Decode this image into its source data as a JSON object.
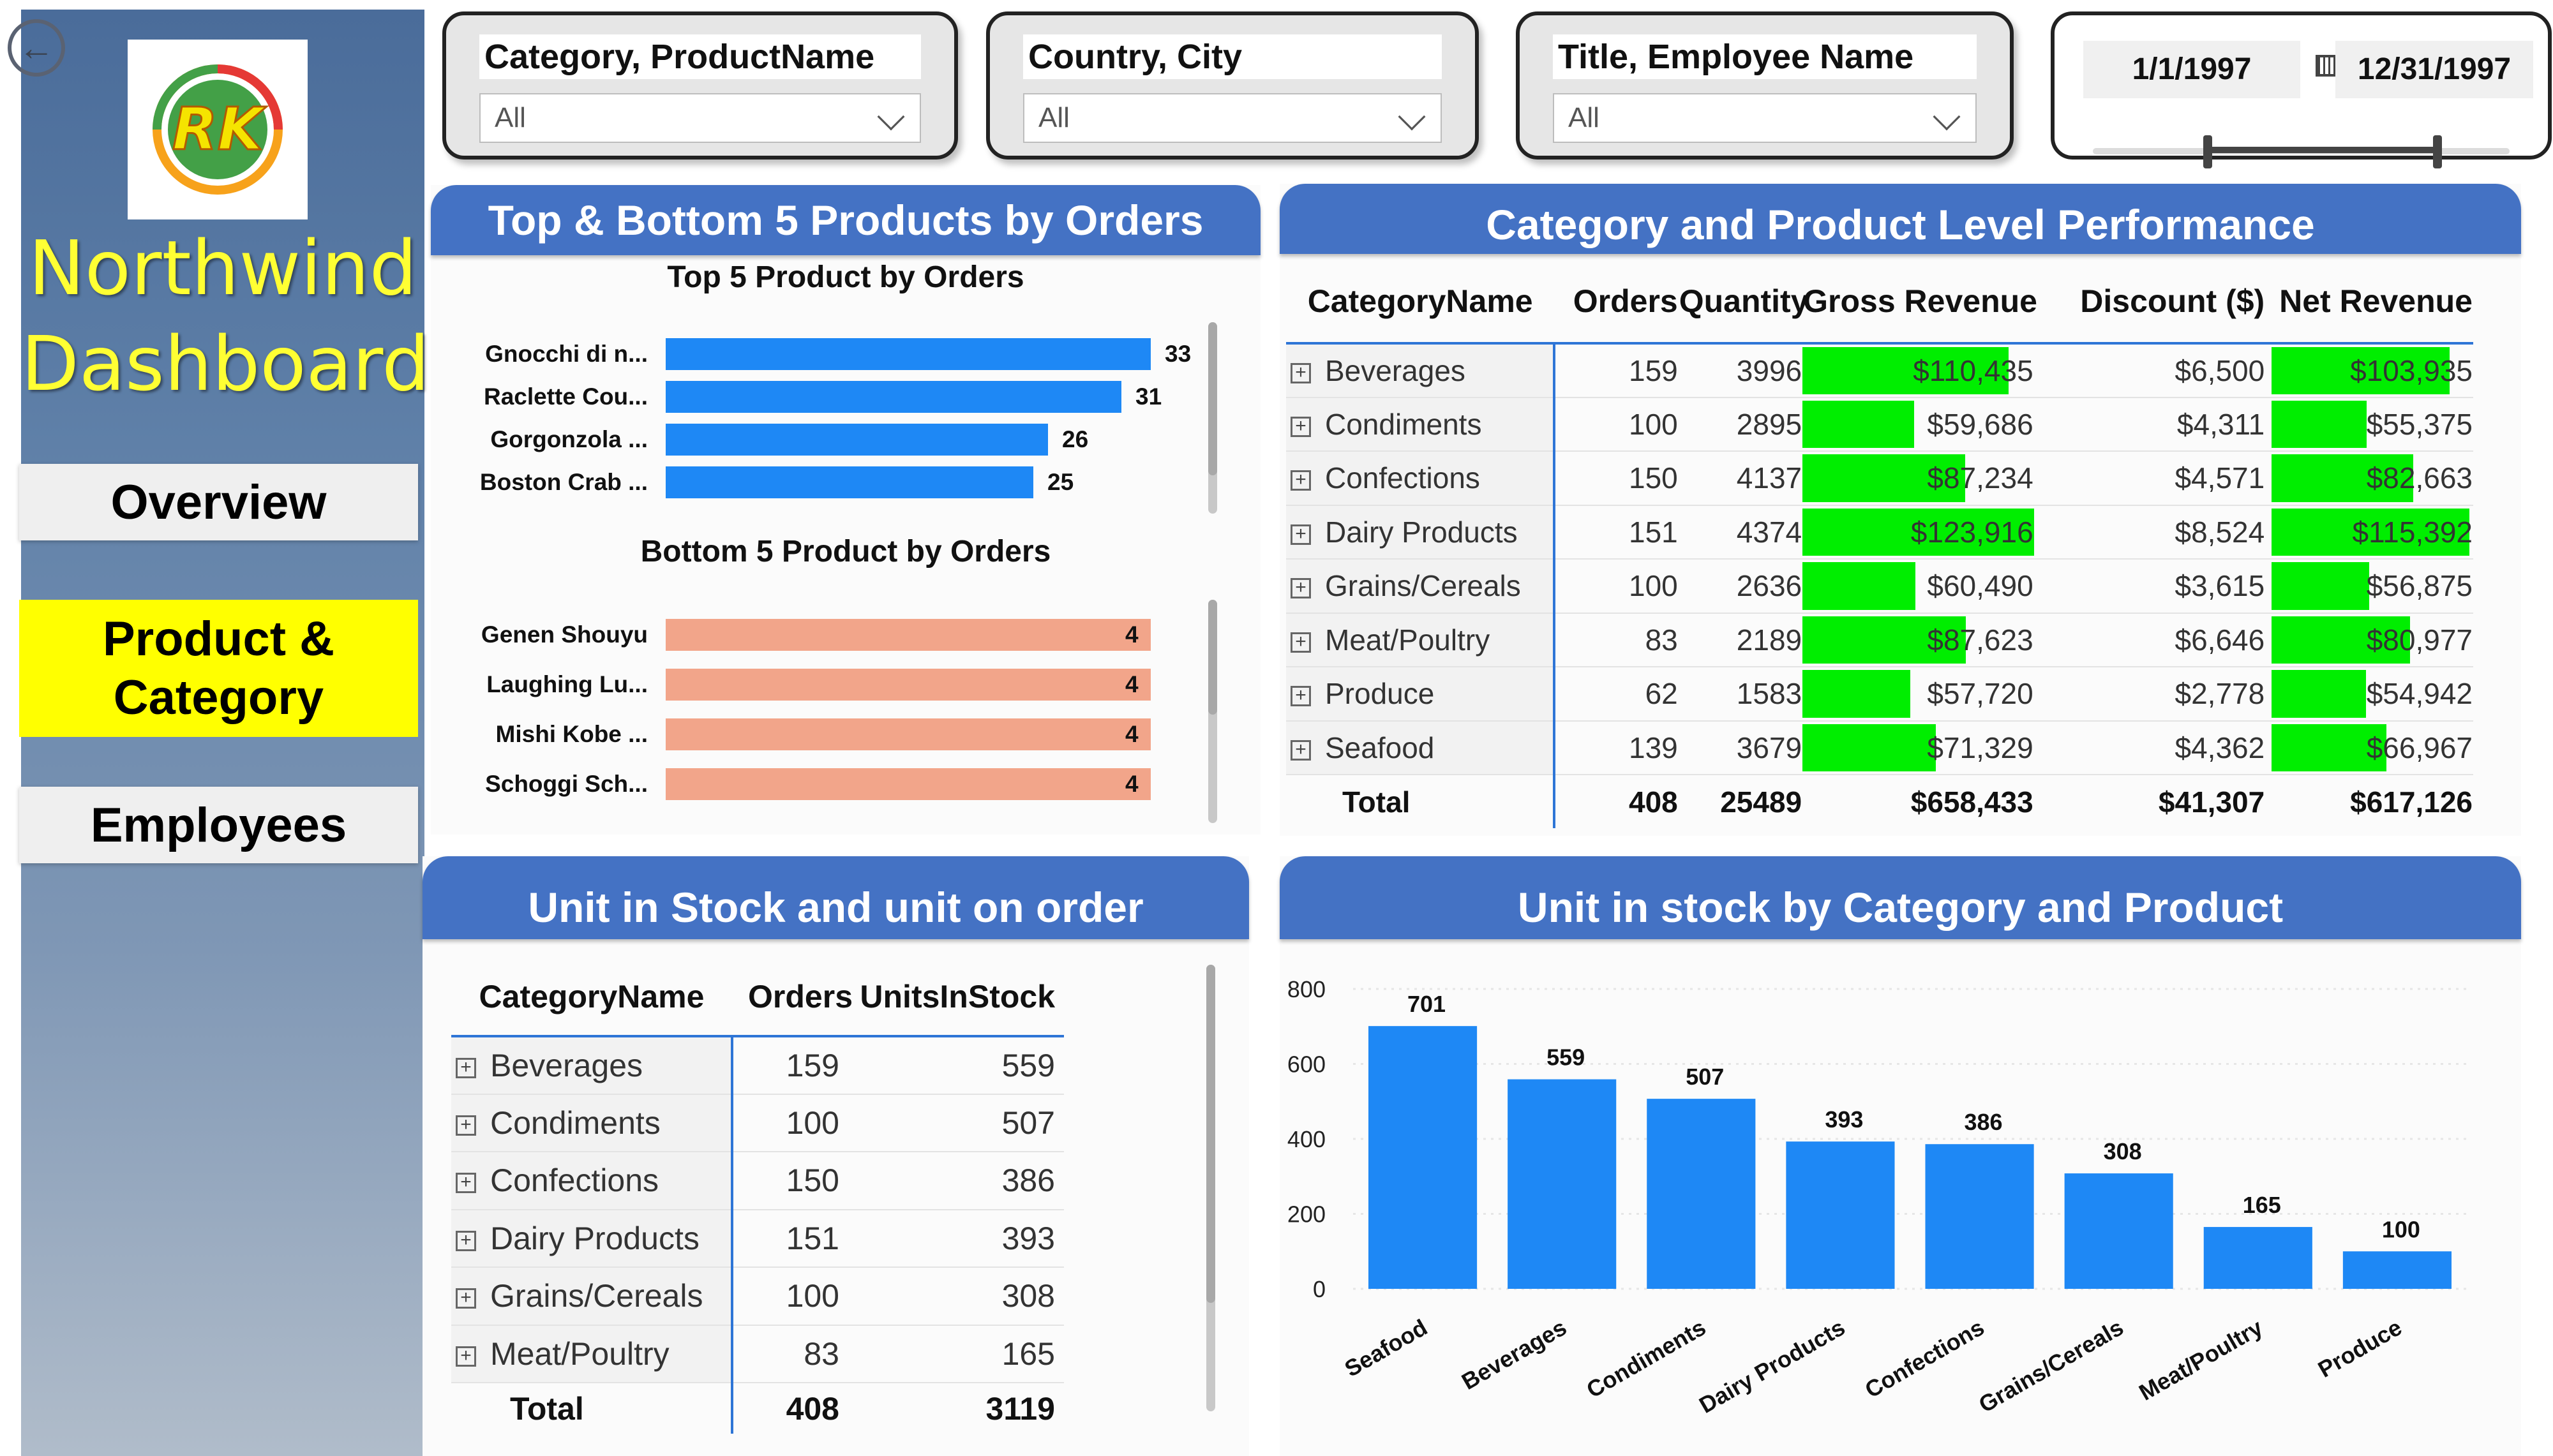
{
  "sidebar": {
    "title_line1": "Northwind",
    "title_line2": "Dashboard",
    "nav": [
      "Overview",
      "Product &\nCategory",
      "Employees"
    ],
    "active_nav": "Product & Category",
    "logo_text": "RK"
  },
  "slicers": [
    {
      "title": "Category, ProductName",
      "value": "All"
    },
    {
      "title": "Country, City",
      "value": "All"
    },
    {
      "title": "Title, Employee Name",
      "value": "All"
    }
  ],
  "date_slicer": {
    "start": "1/1/1997",
    "end": "12/31/1997"
  },
  "top_bottom": {
    "header": "Top & Bottom 5 Products by Orders",
    "top_title": "Top 5 Product by Orders",
    "bottom_title": "Bottom 5 Product by Orders",
    "top": [
      {
        "label": "Gnocchi di n...",
        "value": 33
      },
      {
        "label": "Raclette Cou...",
        "value": 31
      },
      {
        "label": "Gorgonzola ...",
        "value": 26
      },
      {
        "label": "Boston Crab ...",
        "value": 25
      }
    ],
    "bottom": [
      {
        "label": "Genen Shouyu",
        "value": 4
      },
      {
        "label": "Laughing Lu...",
        "value": 4
      },
      {
        "label": "Mishi Kobe ...",
        "value": 4
      },
      {
        "label": "Schoggi Sch...",
        "value": 4
      }
    ],
    "colors": {
      "top": "#1e88f5",
      "bottom": "#f2a58a"
    }
  },
  "performance": {
    "header": "Category and Product Level Performance",
    "columns": [
      "CategoryName",
      "Orders",
      "Quantity",
      "Gross Revenue",
      "Discount ($)",
      "Net Revenue"
    ],
    "rows": [
      {
        "name": "Beverages",
        "orders": "159",
        "quantity": "3996",
        "gross": "$110,435",
        "gross_val": 110435,
        "discount": "$6,500",
        "net": "$103,935",
        "net_val": 103935
      },
      {
        "name": "Condiments",
        "orders": "100",
        "quantity": "2895",
        "gross": "$59,686",
        "gross_val": 59686,
        "discount": "$4,311",
        "net": "$55,375",
        "net_val": 55375
      },
      {
        "name": "Confections",
        "orders": "150",
        "quantity": "4137",
        "gross": "$87,234",
        "gross_val": 87234,
        "discount": "$4,571",
        "net": "$82,663",
        "net_val": 82663
      },
      {
        "name": "Dairy Products",
        "orders": "151",
        "quantity": "4374",
        "gross": "$123,916",
        "gross_val": 123916,
        "discount": "$8,524",
        "net": "$115,392",
        "net_val": 115392
      },
      {
        "name": "Grains/Cereals",
        "orders": "100",
        "quantity": "2636",
        "gross": "$60,490",
        "gross_val": 60490,
        "discount": "$3,615",
        "net": "$56,875",
        "net_val": 56875
      },
      {
        "name": "Meat/Poultry",
        "orders": "83",
        "quantity": "2189",
        "gross": "$87,623",
        "gross_val": 87623,
        "discount": "$6,646",
        "net": "$80,977",
        "net_val": 80977
      },
      {
        "name": "Produce",
        "orders": "62",
        "quantity": "1583",
        "gross": "$57,720",
        "gross_val": 57720,
        "discount": "$2,778",
        "net": "$54,942",
        "net_val": 54942
      },
      {
        "name": "Seafood",
        "orders": "139",
        "quantity": "3679",
        "gross": "$71,329",
        "gross_val": 71329,
        "discount": "$4,362",
        "net": "$66,967",
        "net_val": 66967
      }
    ],
    "total": {
      "name": "Total",
      "orders": "408",
      "quantity": "25489",
      "gross": "$658,433",
      "discount": "$41,307",
      "net": "$617,126"
    },
    "bar_color": "#00ee00"
  },
  "stock": {
    "header": "Unit in Stock and unit on order",
    "columns": [
      "CategoryName",
      "Orders",
      "UnitsInStock"
    ],
    "rows": [
      {
        "name": "Beverages",
        "orders": "159",
        "units": "559"
      },
      {
        "name": "Condiments",
        "orders": "100",
        "units": "507"
      },
      {
        "name": "Confections",
        "orders": "150",
        "units": "386"
      },
      {
        "name": "Dairy Products",
        "orders": "151",
        "units": "393"
      },
      {
        "name": "Grains/Cereals",
        "orders": "100",
        "units": "308"
      },
      {
        "name": "Meat/Poultry",
        "orders": "83",
        "units": "165"
      }
    ],
    "total": {
      "name": "Total",
      "orders": "408",
      "units": "3119"
    }
  },
  "chart_header": "Unit in stock by Category and Product",
  "chart_data": {
    "type": "bar",
    "categories": [
      "Seafood",
      "Beverages",
      "Condiments",
      "Dairy Products",
      "Confections",
      "Grains/Cereals",
      "Meat/Poultry",
      "Produce"
    ],
    "values": [
      701,
      559,
      507,
      393,
      386,
      308,
      165,
      100
    ],
    "title": "",
    "xlabel": "",
    "ylabel": "",
    "ylim": [
      0,
      800
    ],
    "yticks": [
      0,
      200,
      400,
      600,
      800
    ],
    "grid": true,
    "data_labels": true,
    "color": "#1e88f5"
  },
  "theme": {
    "header_blue": "#4472c4",
    "accent_blue": "#2e75d6",
    "highlight_yellow": "#ffff00"
  }
}
